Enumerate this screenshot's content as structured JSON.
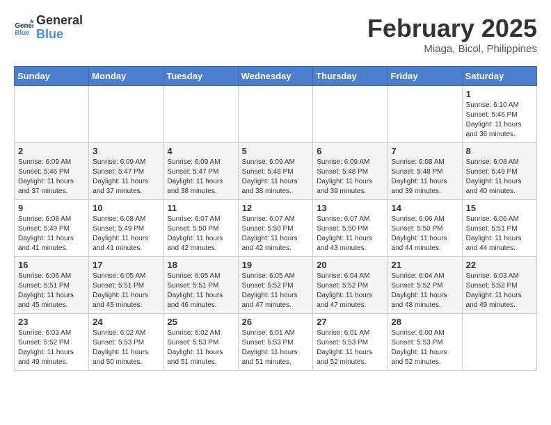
{
  "header": {
    "logo_general": "General",
    "logo_blue": "Blue",
    "month": "February 2025",
    "location": "Miaga, Bicol, Philippines"
  },
  "days_of_week": [
    "Sunday",
    "Monday",
    "Tuesday",
    "Wednesday",
    "Thursday",
    "Friday",
    "Saturday"
  ],
  "weeks": [
    [
      {
        "day": "",
        "info": ""
      },
      {
        "day": "",
        "info": ""
      },
      {
        "day": "",
        "info": ""
      },
      {
        "day": "",
        "info": ""
      },
      {
        "day": "",
        "info": ""
      },
      {
        "day": "",
        "info": ""
      },
      {
        "day": "1",
        "info": "Sunrise: 6:10 AM\nSunset: 5:46 PM\nDaylight: 11 hours and 36 minutes."
      }
    ],
    [
      {
        "day": "2",
        "info": "Sunrise: 6:09 AM\nSunset: 5:46 PM\nDaylight: 11 hours and 37 minutes."
      },
      {
        "day": "3",
        "info": "Sunrise: 6:09 AM\nSunset: 5:47 PM\nDaylight: 11 hours and 37 minutes."
      },
      {
        "day": "4",
        "info": "Sunrise: 6:09 AM\nSunset: 5:47 PM\nDaylight: 11 hours and 38 minutes."
      },
      {
        "day": "5",
        "info": "Sunrise: 6:09 AM\nSunset: 5:48 PM\nDaylight: 11 hours and 38 minutes."
      },
      {
        "day": "6",
        "info": "Sunrise: 6:09 AM\nSunset: 5:48 PM\nDaylight: 11 hours and 39 minutes."
      },
      {
        "day": "7",
        "info": "Sunrise: 6:08 AM\nSunset: 5:48 PM\nDaylight: 11 hours and 39 minutes."
      },
      {
        "day": "8",
        "info": "Sunrise: 6:08 AM\nSunset: 5:49 PM\nDaylight: 11 hours and 40 minutes."
      }
    ],
    [
      {
        "day": "9",
        "info": "Sunrise: 6:08 AM\nSunset: 5:49 PM\nDaylight: 11 hours and 41 minutes."
      },
      {
        "day": "10",
        "info": "Sunrise: 6:08 AM\nSunset: 5:49 PM\nDaylight: 11 hours and 41 minutes."
      },
      {
        "day": "11",
        "info": "Sunrise: 6:07 AM\nSunset: 5:50 PM\nDaylight: 11 hours and 42 minutes."
      },
      {
        "day": "12",
        "info": "Sunrise: 6:07 AM\nSunset: 5:50 PM\nDaylight: 11 hours and 42 minutes."
      },
      {
        "day": "13",
        "info": "Sunrise: 6:07 AM\nSunset: 5:50 PM\nDaylight: 11 hours and 43 minutes."
      },
      {
        "day": "14",
        "info": "Sunrise: 6:06 AM\nSunset: 5:50 PM\nDaylight: 11 hours and 44 minutes."
      },
      {
        "day": "15",
        "info": "Sunrise: 6:06 AM\nSunset: 5:51 PM\nDaylight: 11 hours and 44 minutes."
      }
    ],
    [
      {
        "day": "16",
        "info": "Sunrise: 6:06 AM\nSunset: 5:51 PM\nDaylight: 11 hours and 45 minutes."
      },
      {
        "day": "17",
        "info": "Sunrise: 6:05 AM\nSunset: 5:51 PM\nDaylight: 11 hours and 45 minutes."
      },
      {
        "day": "18",
        "info": "Sunrise: 6:05 AM\nSunset: 5:51 PM\nDaylight: 11 hours and 46 minutes."
      },
      {
        "day": "19",
        "info": "Sunrise: 6:05 AM\nSunset: 5:52 PM\nDaylight: 11 hours and 47 minutes."
      },
      {
        "day": "20",
        "info": "Sunrise: 6:04 AM\nSunset: 5:52 PM\nDaylight: 11 hours and 47 minutes."
      },
      {
        "day": "21",
        "info": "Sunrise: 6:04 AM\nSunset: 5:52 PM\nDaylight: 11 hours and 48 minutes."
      },
      {
        "day": "22",
        "info": "Sunrise: 6:03 AM\nSunset: 5:52 PM\nDaylight: 11 hours and 49 minutes."
      }
    ],
    [
      {
        "day": "23",
        "info": "Sunrise: 6:03 AM\nSunset: 5:52 PM\nDaylight: 11 hours and 49 minutes."
      },
      {
        "day": "24",
        "info": "Sunrise: 6:02 AM\nSunset: 5:53 PM\nDaylight: 11 hours and 50 minutes."
      },
      {
        "day": "25",
        "info": "Sunrise: 6:02 AM\nSunset: 5:53 PM\nDaylight: 11 hours and 51 minutes."
      },
      {
        "day": "26",
        "info": "Sunrise: 6:01 AM\nSunset: 5:53 PM\nDaylight: 11 hours and 51 minutes."
      },
      {
        "day": "27",
        "info": "Sunrise: 6:01 AM\nSunset: 5:53 PM\nDaylight: 11 hours and 52 minutes."
      },
      {
        "day": "28",
        "info": "Sunrise: 6:00 AM\nSunset: 5:53 PM\nDaylight: 11 hours and 52 minutes."
      },
      {
        "day": "",
        "info": ""
      }
    ]
  ]
}
